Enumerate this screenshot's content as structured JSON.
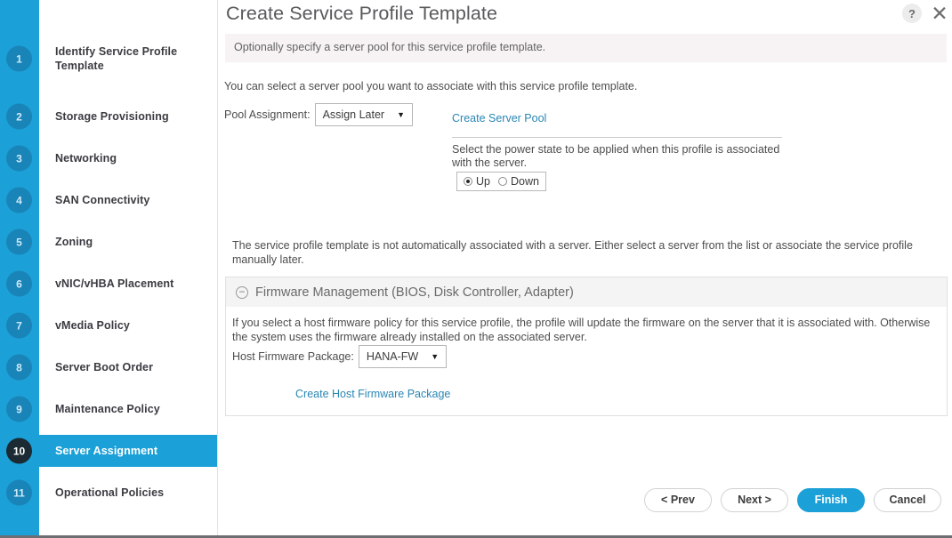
{
  "window": {
    "title": "Create Service Profile Template",
    "help_icon": "question-mark-icon",
    "close_icon": "close-icon",
    "help_label": "?",
    "close_label": "✕"
  },
  "colors": {
    "accent_blue": "#1ba0d7",
    "active_badge": "#1b2a33",
    "link_blue": "#2a86b4",
    "subtitle_band": "#f7f3f4",
    "panel_header": "#f4f4f4"
  },
  "sidebar": {
    "steps": [
      {
        "number": "1",
        "label": "Identify Service Profile Template",
        "active": false,
        "two_line": true
      },
      {
        "number": "2",
        "label": "Storage Provisioning",
        "active": false,
        "two_line": false
      },
      {
        "number": "3",
        "label": "Networking",
        "active": false,
        "two_line": false
      },
      {
        "number": "4",
        "label": "SAN Connectivity",
        "active": false,
        "two_line": false
      },
      {
        "number": "5",
        "label": "Zoning",
        "active": false,
        "two_line": false
      },
      {
        "number": "6",
        "label": "vNIC/vHBA Placement",
        "active": false,
        "two_line": false
      },
      {
        "number": "7",
        "label": "vMedia Policy",
        "active": false,
        "two_line": false
      },
      {
        "number": "8",
        "label": "Server Boot Order",
        "active": false,
        "two_line": false
      },
      {
        "number": "9",
        "label": "Maintenance Policy",
        "active": false,
        "two_line": false
      },
      {
        "number": "10",
        "label": "Server Assignment",
        "active": true,
        "two_line": false
      },
      {
        "number": "11",
        "label": "Operational Policies",
        "active": false,
        "two_line": false
      }
    ]
  },
  "main": {
    "subtitle": "Optionally specify a server pool for this service profile template.",
    "intro": "You can select a server pool you want to associate with this service profile template.",
    "pool_assignment": {
      "label": "Pool Assignment:",
      "value": "Assign Later",
      "caret": "▼"
    },
    "create_server_pool_link": "Create Server Pool",
    "power_state": {
      "description": "Select the power state to be applied when this profile is associated with the server.",
      "options": [
        {
          "label": "Up",
          "checked": true
        },
        {
          "label": "Down",
          "checked": false
        }
      ]
    },
    "note": "The service profile template is not automatically associated with a server. Either select a server from the list or associate the service profile manually later.",
    "firmware": {
      "toggle_icon": "collapse-minus-icon",
      "toggle_glyph": "−",
      "title": "Firmware Management (BIOS, Disk Controller, Adapter)",
      "description": "If you select a host firmware policy for this service profile, the profile will update the firmware on the server that it is associated with. Otherwise the system uses the firmware already installed on the associated server.",
      "host_firmware_package": {
        "label": "Host Firmware Package:",
        "value": "HANA-FW",
        "caret": "▼"
      },
      "create_link": "Create Host Firmware Package"
    }
  },
  "footer": {
    "buttons": [
      {
        "label": "< Prev",
        "primary": false
      },
      {
        "label": "Next >",
        "primary": false
      },
      {
        "label": "Finish",
        "primary": true
      },
      {
        "label": "Cancel",
        "primary": false
      }
    ]
  }
}
